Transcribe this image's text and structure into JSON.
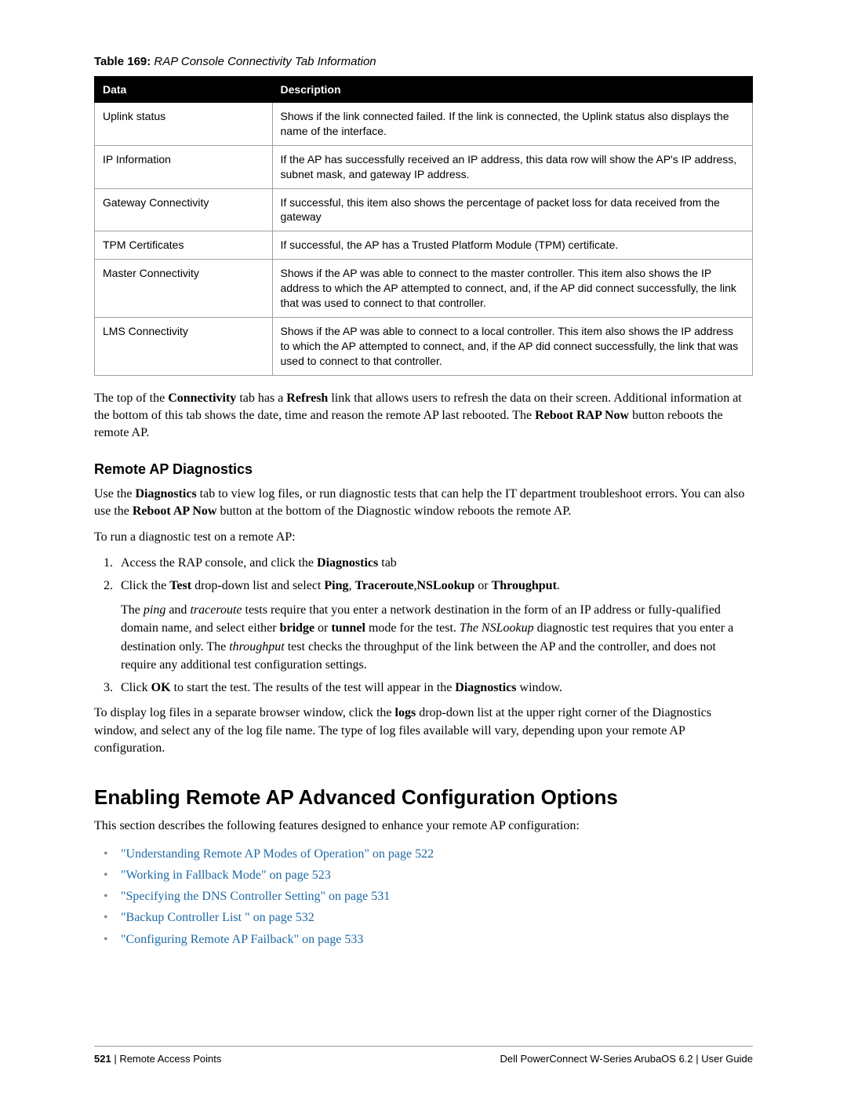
{
  "table_caption_prefix": "Table 169:",
  "table_caption_title": " RAP Console Connectivity Tab Information",
  "table": {
    "headers": {
      "data": "Data",
      "desc": "Description"
    },
    "rows": [
      {
        "data": "Uplink status",
        "desc": "Shows if the link connected failed. If the link is connected, the Uplink status also displays the name of the interface."
      },
      {
        "data": "IP Information",
        "desc": "If the AP has successfully received an IP address, this data row will show the AP's IP address, subnet mask, and gateway IP address."
      },
      {
        "data": "Gateway Connectivity",
        "desc": "If successful, this item also shows the percentage of packet loss for data received from the gateway"
      },
      {
        "data": "TPM Certificates",
        "desc": "If successful, the AP has a Trusted Platform Module (TPM) certificate."
      },
      {
        "data": "Master Connectivity",
        "desc": "Shows if the AP was able to connect to the master controller. This item also shows the IP address to which the AP attempted to connect, and, if the AP did connect successfully, the link that was used to connect to that controller."
      },
      {
        "data": "LMS Connectivity",
        "desc": "Shows if the AP was able to connect to a local controller. This item also shows the IP address to which the AP attempted to connect, and, if the AP did connect successfully, the link that was used to connect to that controller."
      }
    ]
  },
  "para1": {
    "t1": "The top of the ",
    "b1": "Connectivity",
    "t2": " tab has a ",
    "b2": "Refresh",
    "t3": " link that allows users to refresh the data on their screen. Additional information at the bottom of this tab shows the date, time and reason the remote AP last rebooted. The ",
    "b3": "Reboot RAP Now",
    "t4": " button reboots the remote AP."
  },
  "h3_diag": "Remote AP Diagnostics",
  "para2": {
    "t1": "Use the ",
    "b1": "Diagnostics",
    "t2": " tab to view log files, or run diagnostic tests that can help the IT department troubleshoot errors. You can also use the ",
    "b2": "Reboot AP Now",
    "t3": " button at the bottom of the Diagnostic window reboots the remote AP."
  },
  "para3": "To run a diagnostic test on a remote AP:",
  "steps": {
    "s1": {
      "t1": "Access the RAP console, and click the ",
      "b1": "Diagnostics",
      "t2": " tab"
    },
    "s2": {
      "t1": "Click the ",
      "b1": "Test",
      "t2": " drop-down list and select ",
      "b2": "Ping",
      "c1": ", ",
      "b3": "Traceroute",
      "c2": ",",
      "b4": "NSLookup",
      "t3": " or ",
      "b5": "Throughput",
      "t4": ".",
      "sub": {
        "t1": "The ",
        "i1": "ping",
        "t2": " and ",
        "i2": "traceroute",
        "t3": " tests require that you enter a network destination in the form of an IP address or fully-qualified domain name, and select either ",
        "b1": "bridge",
        "t4": " or ",
        "b2": "tunnel",
        "t5": " mode for the test. ",
        "i3": "The NSLookup",
        "t6": " diagnostic test requires that you enter a destination only. The ",
        "i4": "throughput",
        "t7": " test checks the throughput of the link between the AP and the controller, and does not require any additional test configuration settings."
      }
    },
    "s3": {
      "t1": "Click ",
      "b1": "OK",
      "t2": " to start the test. The results of the test will appear in the ",
      "b2": "Diagnostics",
      "t3": " window."
    }
  },
  "para4": {
    "t1": "To display log files in a separate browser window, click the ",
    "b1": "logs",
    "t2": " drop-down list at the upper right corner of the Diagnostics window, and select any of the log file name. The type of log files available will vary, depending upon your remote AP configuration."
  },
  "h2_enable": "Enabling Remote AP Advanced Configuration Options",
  "para5": "This section describes the following features designed to enhance your remote AP configuration:",
  "links": [
    "\"Understanding Remote AP Modes of Operation\" on page 522",
    "\"Working in Fallback Mode\" on page 523",
    "\"Specifying the DNS Controller Setting\" on page 531",
    "\"Backup Controller List \" on page 532",
    "\"Configuring Remote AP Failback\" on page 533"
  ],
  "footer": {
    "page_num": "521",
    "left_sep": " | ",
    "left_text": "Remote Access Points",
    "right": "Dell PowerConnect W-Series ArubaOS 6.2  |  User Guide"
  }
}
